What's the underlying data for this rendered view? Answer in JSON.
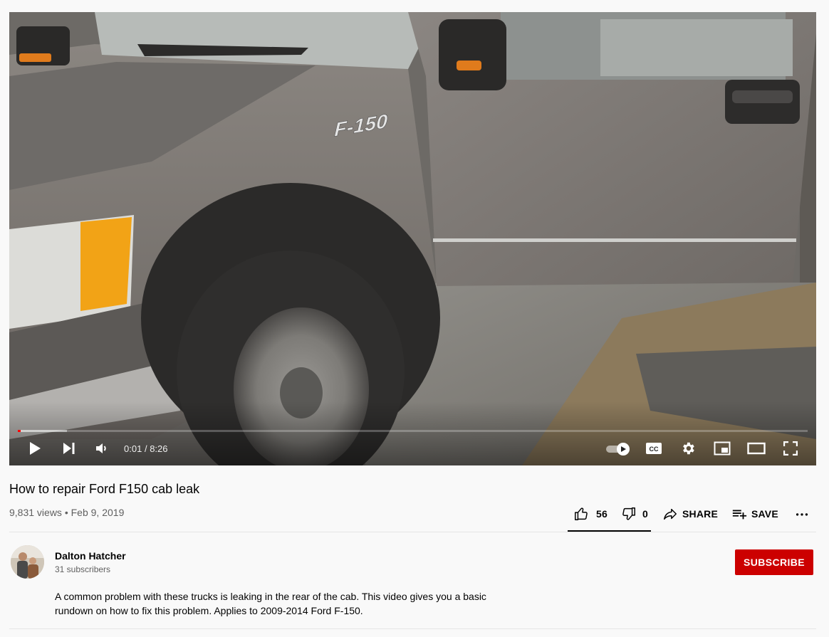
{
  "player": {
    "current_time": "0:01",
    "separator": "/",
    "duration": "8:26",
    "progress_played": 0.004,
    "progress_loaded": 0.062,
    "autoplay_on": true,
    "colors": {
      "progress": "#ff0000"
    }
  },
  "video": {
    "title": "How to repair Ford F150 cab leak",
    "views": "9,831 views",
    "bullet": "•",
    "date": "Feb 9, 2019",
    "badge_text": "F-150"
  },
  "actions": {
    "like_count": "56",
    "dislike_count": "0",
    "share_label": "SHARE",
    "save_label": "SAVE"
  },
  "channel": {
    "name": "Dalton Hatcher",
    "subscribers": "31 subscribers",
    "subscribe_label": "SUBSCRIBE"
  },
  "description": "A common problem with these trucks is leaking in the rear of the cab. This video gives you a basic rundown on how to fix this problem. Applies to 2009-2014 Ford F-150.",
  "colors": {
    "subscribe_bg": "#cc0000",
    "text_primary": "#030303",
    "text_secondary": "#606060",
    "background": "#f9f9f9"
  }
}
